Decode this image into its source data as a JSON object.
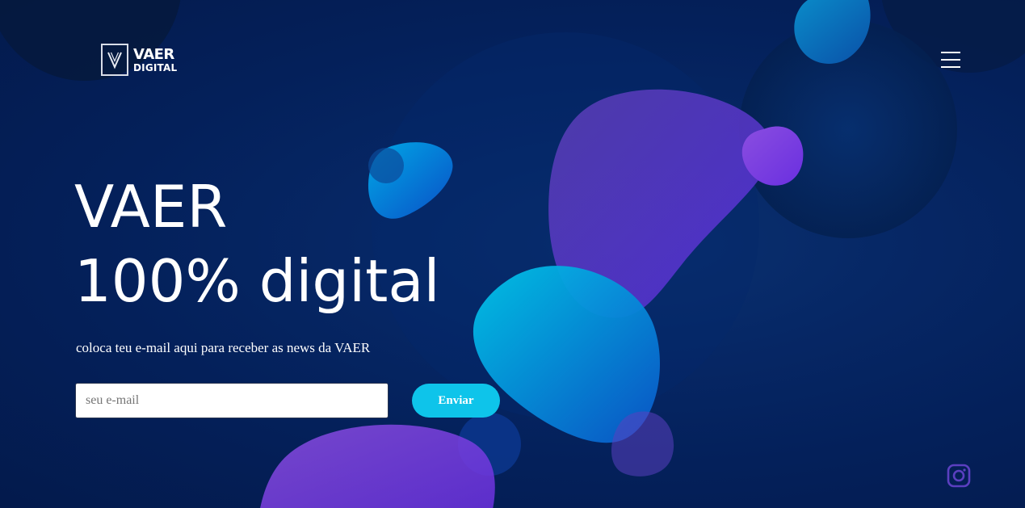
{
  "brand": {
    "logo_line1": "VAER",
    "logo_line2": "DIGITAL",
    "monogram": "V"
  },
  "header": {
    "menu_icon": "hamburger-menu-icon"
  },
  "hero": {
    "title_line1": "VAER",
    "title_line2": "100% digital",
    "subtitle": "coloca teu e-mail aqui para receber as news da VAER"
  },
  "newsletter": {
    "email_placeholder": "seu e-mail",
    "email_value": "",
    "submit_label": "Enviar"
  },
  "social": {
    "instagram_icon": "instagram-icon"
  },
  "colors": {
    "background": "#04205a",
    "accent_cyan": "#0ec4ea",
    "accent_purple": "#6a3fd6",
    "text": "#ffffff"
  }
}
